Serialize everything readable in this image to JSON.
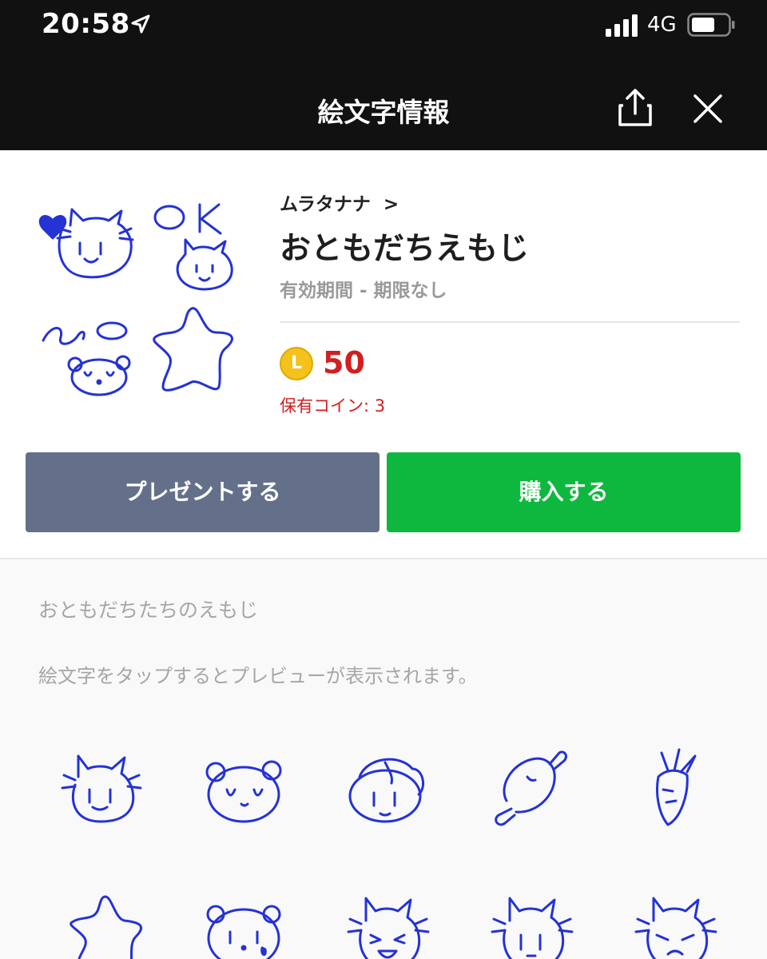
{
  "status_bar": {
    "time": "20:58",
    "network": "4G"
  },
  "nav": {
    "title": "絵文字情報",
    "share_icon": "share-icon",
    "close_icon": "close-icon"
  },
  "product": {
    "author": "ムラタナナ",
    "title": "おともだちえもじ",
    "validity": "有効期間 - 期限なし",
    "coin_letter": "L",
    "price": "50",
    "owned_coins": "保有コイン: 3"
  },
  "actions": {
    "gift_label": "プレゼントする",
    "buy_label": "購入する"
  },
  "section": {
    "title": "おともだちたちのえもじ",
    "hint": "絵文字をタップするとプレビューが表示されます。"
  },
  "emojis": [
    "cat-face-emoji",
    "bear-face-emoji",
    "bunny-face-emoji",
    "meat-emoji",
    "carrot-emoji",
    "star-emoji",
    "crying-bear-emoji",
    "laughing-cat-emoji",
    "shy-cat-emoji",
    "squint-cat-emoji"
  ],
  "colors": {
    "accent_green": "#0eb83e",
    "gift_gray": "#647089",
    "price_red": "#d21f1f",
    "ink_blue": "#2432d6"
  }
}
